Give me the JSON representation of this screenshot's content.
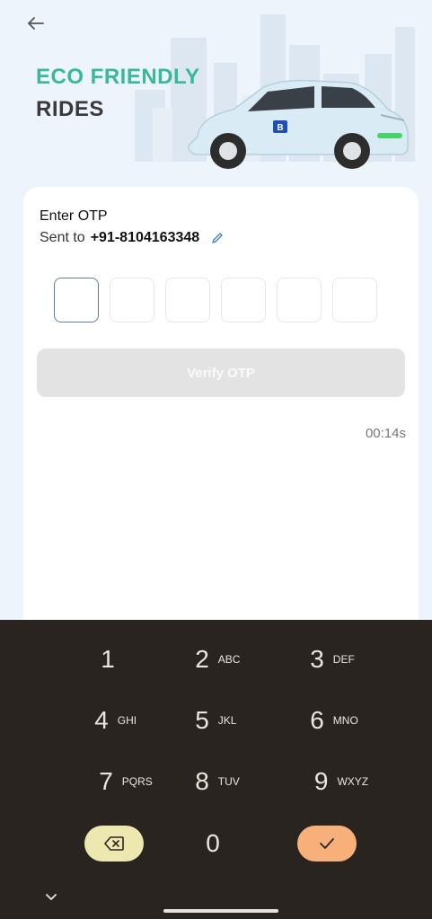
{
  "hero": {
    "back_icon": "arrow-left-icon",
    "title_line1": "ECO FRIENDLY",
    "title_line2": "RIDES",
    "title_line1_color": "#3ab89a",
    "title_line2_color": "#3a3a3a"
  },
  "otp": {
    "heading": "Enter OTP",
    "sent_to_label": "Sent to",
    "phone": "+91-8104163348",
    "edit_icon": "pencil-icon",
    "digits": [
      "",
      "",
      "",
      "",
      "",
      ""
    ],
    "verify_label": "Verify OTP",
    "timer": "00:14s"
  },
  "keyboard": {
    "keys": [
      {
        "num": "1",
        "letters": ""
      },
      {
        "num": "2",
        "letters": "ABC"
      },
      {
        "num": "3",
        "letters": "DEF"
      },
      {
        "num": "4",
        "letters": "GHI"
      },
      {
        "num": "5",
        "letters": "JKL"
      },
      {
        "num": "6",
        "letters": "MNO"
      },
      {
        "num": "7",
        "letters": "PQRS"
      },
      {
        "num": "8",
        "letters": "TUV"
      },
      {
        "num": "9",
        "letters": "WXYZ"
      },
      {
        "num": "0",
        "letters": ""
      }
    ],
    "backspace_icon": "backspace-icon",
    "enter_icon": "check-icon",
    "hide_icon": "chevron-down-icon",
    "background": "#2a2420",
    "backspace_color": "#ede8b0",
    "enter_color": "#f8b07a"
  }
}
